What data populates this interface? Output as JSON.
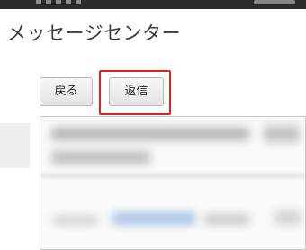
{
  "header": {
    "title": "メッセージセンター"
  },
  "toolbar": {
    "back_label": "戻る",
    "reply_label": "返信"
  },
  "colors": {
    "highlight": "#e0241b",
    "title_text": "#3c3c3c"
  }
}
